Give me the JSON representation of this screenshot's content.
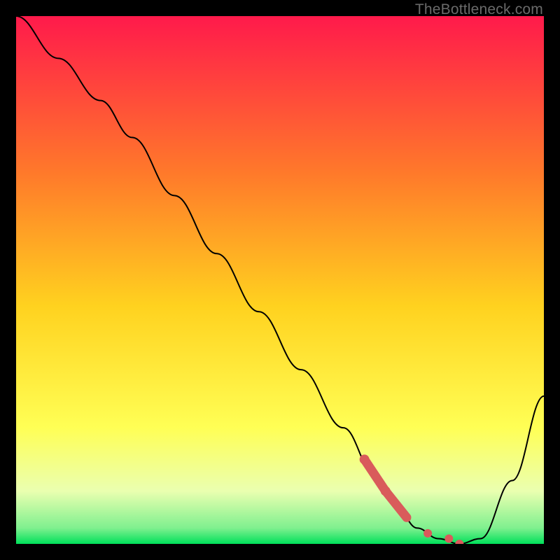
{
  "watermark": "TheBottleneck.com",
  "colors": {
    "gradient_top": "#ff1a4b",
    "gradient_mid_upper": "#ff6a2f",
    "gradient_mid": "#ffd21f",
    "gradient_mid_lower": "#ffff40",
    "gradient_pale": "#f7ffbf",
    "gradient_bottom": "#00e05a",
    "curve": "#000000",
    "dotted": "#d95b5b",
    "frame_bg": "#000000"
  },
  "chart_data": {
    "type": "line",
    "title": "",
    "xlabel": "",
    "ylabel": "",
    "xlim": [
      0,
      100
    ],
    "ylim": [
      0,
      100
    ],
    "series": [
      {
        "name": "bottleneck-curve",
        "x": [
          0,
          8,
          16,
          22,
          30,
          38,
          46,
          54,
          62,
          68,
          72,
          76,
          80,
          84,
          88,
          94,
          100
        ],
        "y": [
          100,
          92,
          84,
          77,
          66,
          55,
          44,
          33,
          22,
          13,
          7,
          3,
          1,
          0,
          1,
          12,
          28
        ]
      }
    ],
    "dotted_segment": {
      "name": "recommended-range",
      "x": [
        66,
        70,
        74,
        78,
        82,
        84
      ],
      "y": [
        16,
        10,
        5,
        2,
        1,
        0
      ]
    }
  }
}
